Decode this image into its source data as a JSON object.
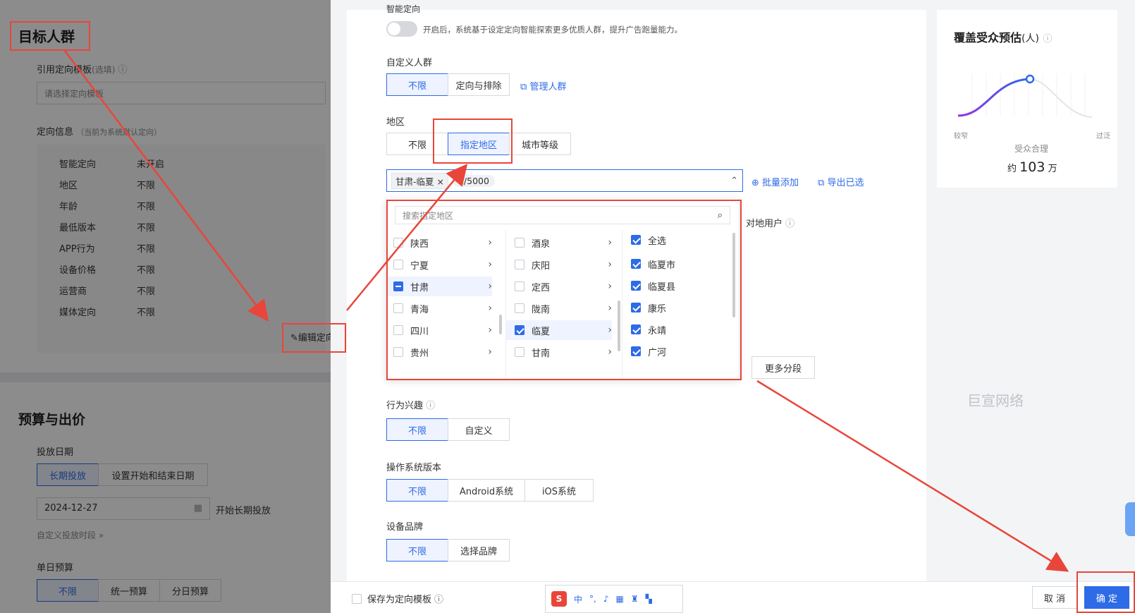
{
  "left": {
    "title": "目标人群",
    "template_label": "引用定向模板",
    "template_optional": "(选填)",
    "template_placeholder": "请选择定向模板",
    "info_label": "定向信息",
    "info_note": "（当前为系统默认定向）",
    "info_rows": [
      {
        "k": "智能定向",
        "v": "未开启"
      },
      {
        "k": "地区",
        "v": "不限"
      },
      {
        "k": "年龄",
        "v": "不限"
      },
      {
        "k": "最低版本",
        "v": "不限"
      },
      {
        "k": "APP行为",
        "v": "不限"
      },
      {
        "k": "设备价格",
        "v": "不限"
      },
      {
        "k": "运营商",
        "v": "不限"
      },
      {
        "k": "媒体定向",
        "v": "不限"
      }
    ],
    "edit_label": "编辑定向",
    "budget_title": "预算与出价",
    "date_label": "投放日期",
    "date_options": [
      "长期投放",
      "设置开始和结束日期"
    ],
    "date_value": "2024-12-27",
    "date_suffix": "开始长期投放",
    "custom_period": "自定义投放时段",
    "daily_label": "单日预算",
    "daily_options": [
      "不限",
      "统一预算",
      "分日预算"
    ]
  },
  "main": {
    "smart_label": "智能定向",
    "smart_desc": "开启后，系统基于设定定向智能探索更多优质人群，提升广告跑量能力。",
    "custom_label": "自定义人群",
    "custom_options": [
      "不限",
      "定向与排除"
    ],
    "manage_link": "管理人群",
    "region_label": "地区",
    "region_options": [
      "不限",
      "指定地区",
      "城市等级"
    ],
    "selected_tag": "甘肃-临夏",
    "selected_count": "1/5000",
    "batch_add": "批量添加",
    "export_selected": "导出已选",
    "hidden_right": "对地用户",
    "search_placeholder": "搜索指定地区",
    "provinces": [
      "陕西",
      "宁夏",
      "甘肃",
      "青海",
      "四川",
      "贵州"
    ],
    "cities": [
      "酒泉",
      "庆阳",
      "定西",
      "陇南",
      "临夏",
      "甘南"
    ],
    "counties": [
      "全选",
      "临夏市",
      "临夏县",
      "康乐",
      "永靖",
      "广河"
    ],
    "more_segments": "更多分段",
    "interest_label": "行为兴趣",
    "interest_options": [
      "不限",
      "自定义"
    ],
    "os_label": "操作系统版本",
    "os_options": [
      "不限",
      "Android系统",
      "iOS系统"
    ],
    "brand_label": "设备品牌",
    "brand_options": [
      "不限",
      "选择品牌"
    ]
  },
  "estimate": {
    "title": "覆盖受众预估",
    "unit": "(人)",
    "narrow": "较窄",
    "wide": "过泛",
    "status": "受众合理",
    "value_prefix": "约",
    "value": "103",
    "value_unit": "万"
  },
  "watermark": "巨宣网络",
  "footer": {
    "save_template": "保存为定向模板",
    "cancel": "取 消",
    "confirm": "确 定",
    "ime": "中"
  },
  "colors": {
    "accent": "#2e6be6",
    "annotation": "#e8463b"
  }
}
